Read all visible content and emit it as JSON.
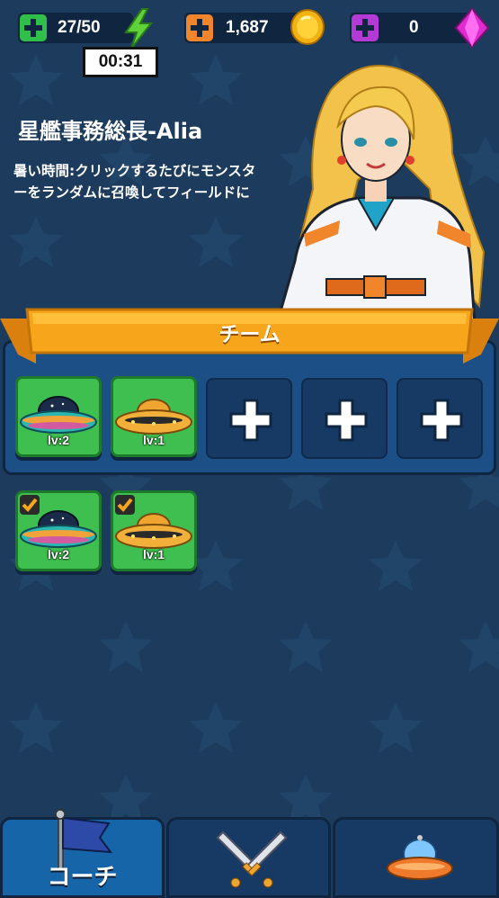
{
  "resources": {
    "energy": {
      "value": "27/50",
      "plus_color": "#2fbf4a",
      "icon": "lightning-icon"
    },
    "coins": {
      "value": "1,687",
      "plus_color": "#f0852b",
      "icon": "coin-icon"
    },
    "gems": {
      "value": "0",
      "plus_color": "#b43ad6",
      "icon": "gem-icon"
    }
  },
  "timer": "00:31",
  "character": {
    "name": "星艦事務総長-Alia",
    "description": "暑い時間:クリックするたびにモンスターをランダムに召喚してフィールドに"
  },
  "team": {
    "label": "チーム",
    "slots": [
      {
        "type": "ufo-blue",
        "level": "lv:2"
      },
      {
        "type": "ufo-orange",
        "level": "lv:1"
      },
      {
        "type": "empty"
      },
      {
        "type": "empty"
      },
      {
        "type": "empty"
      }
    ]
  },
  "collection": [
    {
      "type": "ufo-blue",
      "level": "lv:2",
      "checked": true
    },
    {
      "type": "ufo-orange",
      "level": "lv:1",
      "checked": true
    }
  ],
  "nav": {
    "tabs": [
      {
        "label": "コーチ",
        "icon": "flag-icon",
        "active": true
      },
      {
        "label": "",
        "icon": "crossed-swords-icon",
        "active": false
      },
      {
        "label": "",
        "icon": "ufo-icon",
        "active": false
      }
    ]
  },
  "colors": {
    "background": "#1d3b5c",
    "banner": "#f7a51b",
    "panel": "#1c4f86",
    "card": "#3fbf4f"
  }
}
